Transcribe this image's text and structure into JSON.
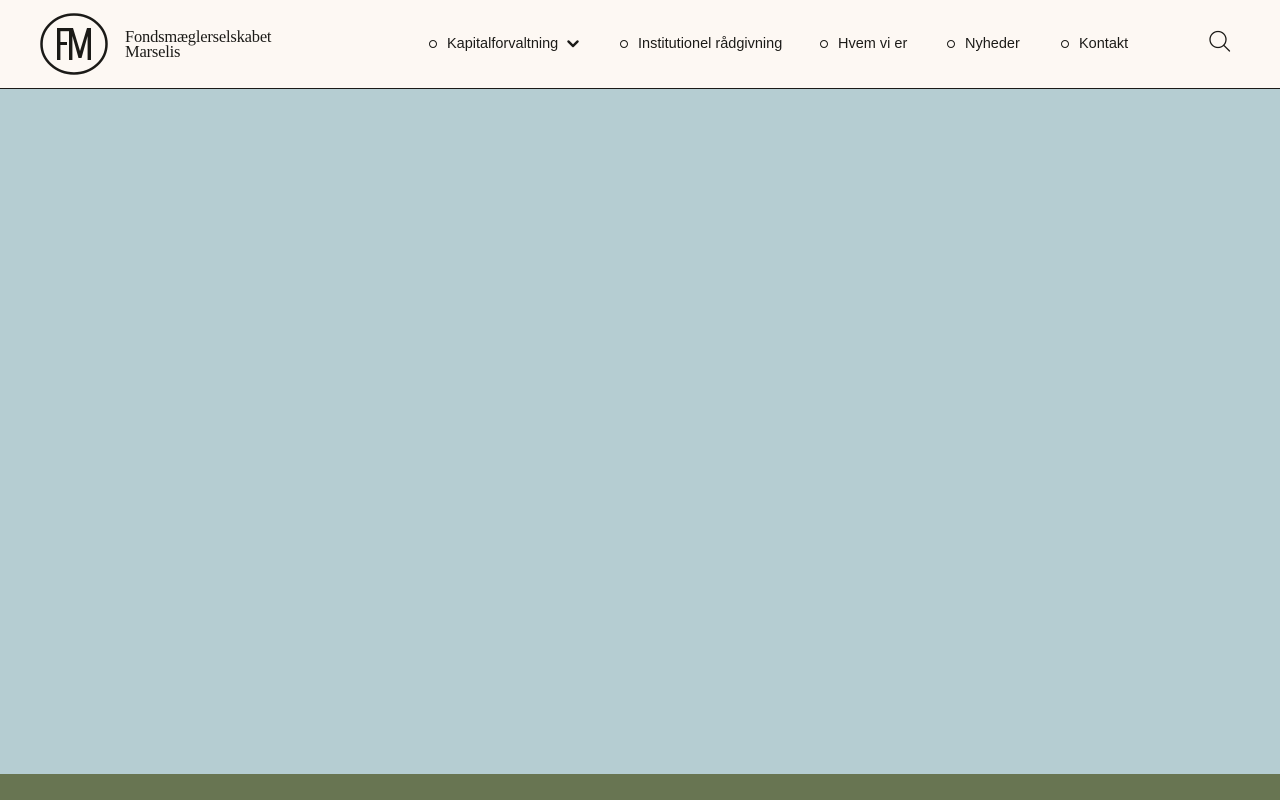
{
  "header": {
    "logo": {
      "line1": "Fondsmæglerselskabet",
      "line2": "Marselis",
      "icon": "fm-monogram-logo-icon"
    },
    "nav": [
      {
        "label": "Kapitalforvaltning",
        "has_dropdown": true
      },
      {
        "label": "Institutionel rådgivning",
        "has_dropdown": false
      },
      {
        "label": "Hvem vi er",
        "has_dropdown": false
      },
      {
        "label": "Nyheder",
        "has_dropdown": false
      },
      {
        "label": "Kontakt",
        "has_dropdown": false
      }
    ],
    "search_icon": "search-icon"
  },
  "colors": {
    "header_bg": "#fdf8f3",
    "text": "#1b1a17",
    "hero_bg": "#b5cdd2",
    "footer_band": "#687552"
  }
}
